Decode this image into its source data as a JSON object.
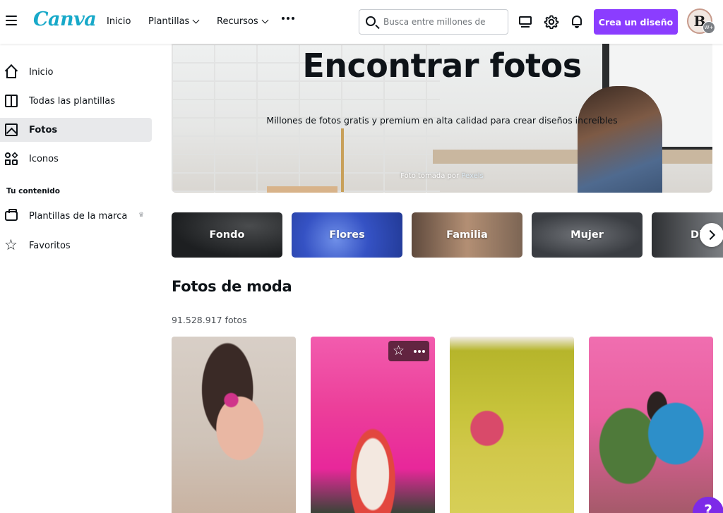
{
  "topbar": {
    "logo": "Canva",
    "nav": [
      {
        "label": "Inicio"
      },
      {
        "label": "Plantillas"
      },
      {
        "label": "Recursos"
      }
    ],
    "search_placeholder": "Busca entre millones de",
    "create_button": "Crea un diseño",
    "avatar_initial": "B",
    "avatar_badge": "W+"
  },
  "sidebar": {
    "items": [
      {
        "label": "Inicio",
        "icon": "home-icon"
      },
      {
        "label": "Todas las plantillas",
        "icon": "templates-icon"
      },
      {
        "label": "Fotos",
        "icon": "photo-icon",
        "active": true
      },
      {
        "label": "Iconos",
        "icon": "shapes-icon"
      }
    ],
    "section_heading": "Tu contenido",
    "content_items": [
      {
        "label": "Plantillas de la marca",
        "icon": "brand-kit-icon",
        "badge": "crown-icon"
      },
      {
        "label": "Favoritos",
        "icon": "star-icon"
      }
    ]
  },
  "hero": {
    "title": "Encontrar fotos",
    "subtitle": "Millones de fotos gratis y premium en alta calidad para crear diseños increíbles",
    "credit_prefix": "Foto tomada por",
    "credit_link": "Pexels"
  },
  "categories": [
    {
      "label": "Fondo",
      "color": "#2b2d2f"
    },
    {
      "label": "Flores",
      "color": "#3d5fc9"
    },
    {
      "label": "Familia",
      "color": "#8c6c54"
    },
    {
      "label": "Mujer",
      "color": "#4a4d52"
    },
    {
      "label": "Di",
      "color": "#55585c"
    }
  ],
  "trending": {
    "title": "Fotos de moda",
    "count": "91.528.917 fotos",
    "photos": [
      {
        "name": "woman-with-orchid"
      },
      {
        "name": "cake-pink-suit"
      },
      {
        "name": "pineapple-bag"
      },
      {
        "name": "two-women-flowers"
      }
    ]
  },
  "colors": {
    "accent": "#8b3dff",
    "logo": "#18a9c9",
    "active_bg": "#e8e9eb",
    "help": "#7d2ae8"
  },
  "help_label": "?"
}
